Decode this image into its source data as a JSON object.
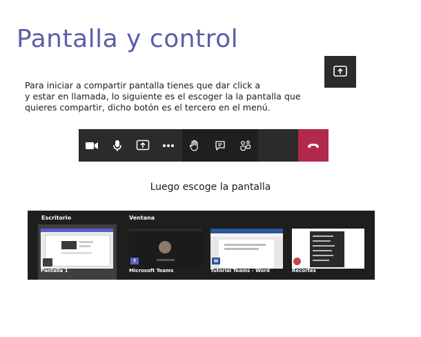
{
  "title": "Pantalla y control",
  "paragraph": {
    "line1": "Para iniciar a compartir pantalla tienes que dar click a",
    "line2": "y estar en llamada, lo siguiente es el escoger la la pantalla que",
    "line3": "quieres compartir, dicho botón es el tercero en el menú."
  },
  "toolbar": {
    "buttons": [
      "camera-icon",
      "microphone-icon",
      "share-screen-icon",
      "more-options-icon",
      "raise-hand-icon",
      "chat-icon",
      "participants-icon",
      "hang-up-icon"
    ],
    "background": "#2b2b2b",
    "hangup_color": "#b3294b"
  },
  "subtitle": "Luego escoge la pantalla",
  "picker": {
    "sections": {
      "desktop": "Escritorio",
      "window": "Ventana"
    },
    "tiles": [
      {
        "label": "Pantalla 1",
        "selected": true
      },
      {
        "label": "Microsoft Teams",
        "selected": false
      },
      {
        "label": "Tutorial Teams - Word",
        "selected": false
      },
      {
        "label": "Recortes",
        "selected": false
      }
    ]
  },
  "colors": {
    "title": "#5b5fa6",
    "picker_bg": "#1e1e1e",
    "teams_purple": "#5b5fc7",
    "word_blue": "#2b579a"
  }
}
